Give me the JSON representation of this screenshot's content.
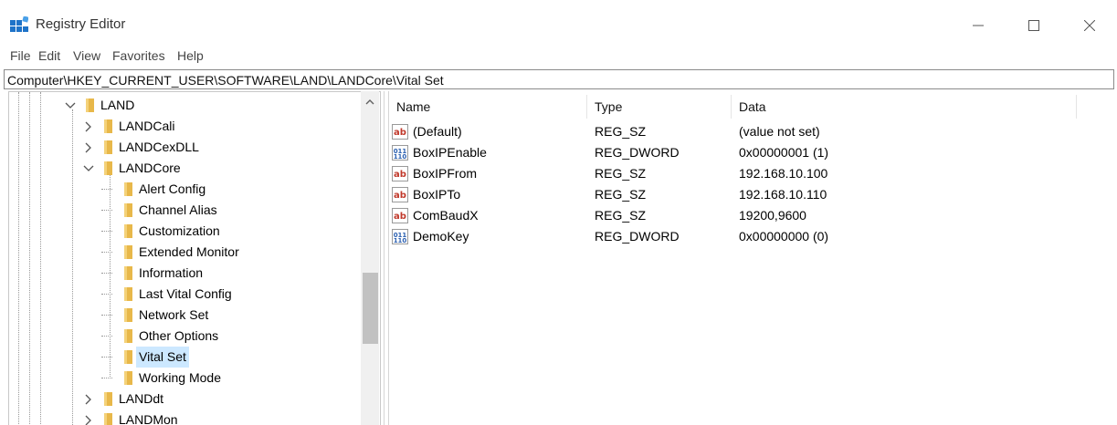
{
  "window": {
    "title": "Registry Editor",
    "controls": [
      "minimize",
      "maximize",
      "close"
    ]
  },
  "menu": [
    "File",
    "Edit",
    "View",
    "Favorites",
    "Help"
  ],
  "address": "Computer\\HKEY_CURRENT_USER\\SOFTWARE\\LAND\\LANDCore\\Vital Set",
  "tree": [
    {
      "label": "LAND",
      "expander": "expanded",
      "level": 0
    },
    {
      "label": "LANDCali",
      "expander": "collapsed",
      "level": 1
    },
    {
      "label": "LANDCexDLL",
      "expander": "collapsed",
      "level": 1
    },
    {
      "label": "LANDCore",
      "expander": "expanded",
      "level": 1
    },
    {
      "label": "Alert Config",
      "expander": "none",
      "level": 2
    },
    {
      "label": "Channel Alias",
      "expander": "none",
      "level": 2
    },
    {
      "label": "Customization",
      "expander": "none",
      "level": 2
    },
    {
      "label": "Extended Monitor",
      "expander": "none",
      "level": 2
    },
    {
      "label": "Information",
      "expander": "none",
      "level": 2
    },
    {
      "label": "Last Vital Config",
      "expander": "none",
      "level": 2
    },
    {
      "label": "Network Set",
      "expander": "none",
      "level": 2
    },
    {
      "label": "Other Options",
      "expander": "none",
      "level": 2
    },
    {
      "label": "Vital Set",
      "expander": "none",
      "level": 2,
      "selected": true
    },
    {
      "label": "Working Mode",
      "expander": "none",
      "level": 2
    },
    {
      "label": "LANDdt",
      "expander": "collapsed",
      "level": 1
    },
    {
      "label": "LANDMon",
      "expander": "collapsed",
      "level": 1
    }
  ],
  "columns": {
    "name": "Name",
    "type": "Type",
    "data": "Data"
  },
  "values": [
    {
      "name": "(Default)",
      "type": "REG_SZ",
      "data": "(value not set)",
      "icon": "string-value-icon"
    },
    {
      "name": "BoxIPEnable",
      "type": "REG_DWORD",
      "data": "0x00000001 (1)",
      "icon": "binary-value-icon"
    },
    {
      "name": "BoxIPFrom",
      "type": "REG_SZ",
      "data": "192.168.10.100",
      "icon": "string-value-icon"
    },
    {
      "name": "BoxIPTo",
      "type": "REG_SZ",
      "data": "192.168.10.110",
      "icon": "string-value-icon"
    },
    {
      "name": "ComBaudX",
      "type": "REG_SZ",
      "data": "19200,9600",
      "icon": "string-value-icon"
    },
    {
      "name": "DemoKey",
      "type": "REG_DWORD",
      "data": "0x00000000 (0)",
      "icon": "binary-value-icon"
    }
  ],
  "colors": {
    "folder": "#e8b84a",
    "selection": "#cce8ff",
    "string_icon_red": "#c0392b",
    "binary_icon_blue": "#2a5fb0"
  }
}
